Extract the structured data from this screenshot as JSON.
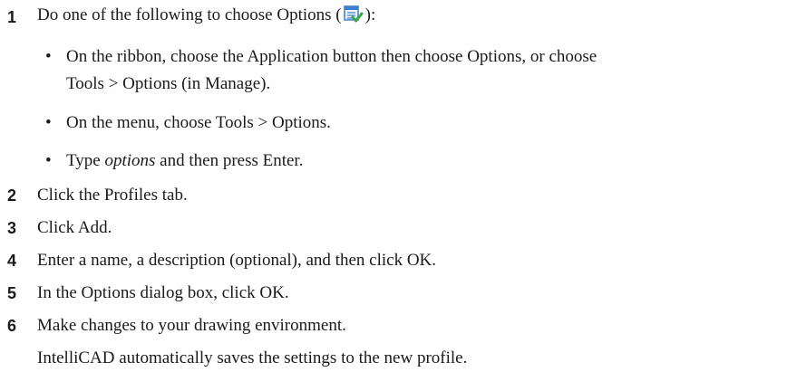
{
  "steps": [
    {
      "num": "1",
      "text_before": "Do one of the following to choose Options (",
      "text_after": "):",
      "icon": "options-icon"
    },
    {
      "num": "2",
      "text": "Click the Profiles tab."
    },
    {
      "num": "3",
      "text": "Click Add."
    },
    {
      "num": "4",
      "text": "Enter a name, a description (optional), and then click OK."
    },
    {
      "num": "5",
      "text": "In the Options dialog box, click OK."
    },
    {
      "num": "6",
      "text": "Make changes to your drawing environment."
    }
  ],
  "bullets": [
    {
      "line1": "On the ribbon, choose the Application button then choose Options, or choose",
      "line2": "Tools > Options (in Manage)."
    },
    {
      "text": "On the menu, choose Tools > Options."
    },
    {
      "before": "Type ",
      "italic": "options",
      "after": " and then press Enter."
    }
  ],
  "note": "IntelliCAD automatically saves the settings to the new profile.",
  "colors": {
    "icon_blue": "#3d7fcf",
    "icon_check": "#3aa842"
  }
}
